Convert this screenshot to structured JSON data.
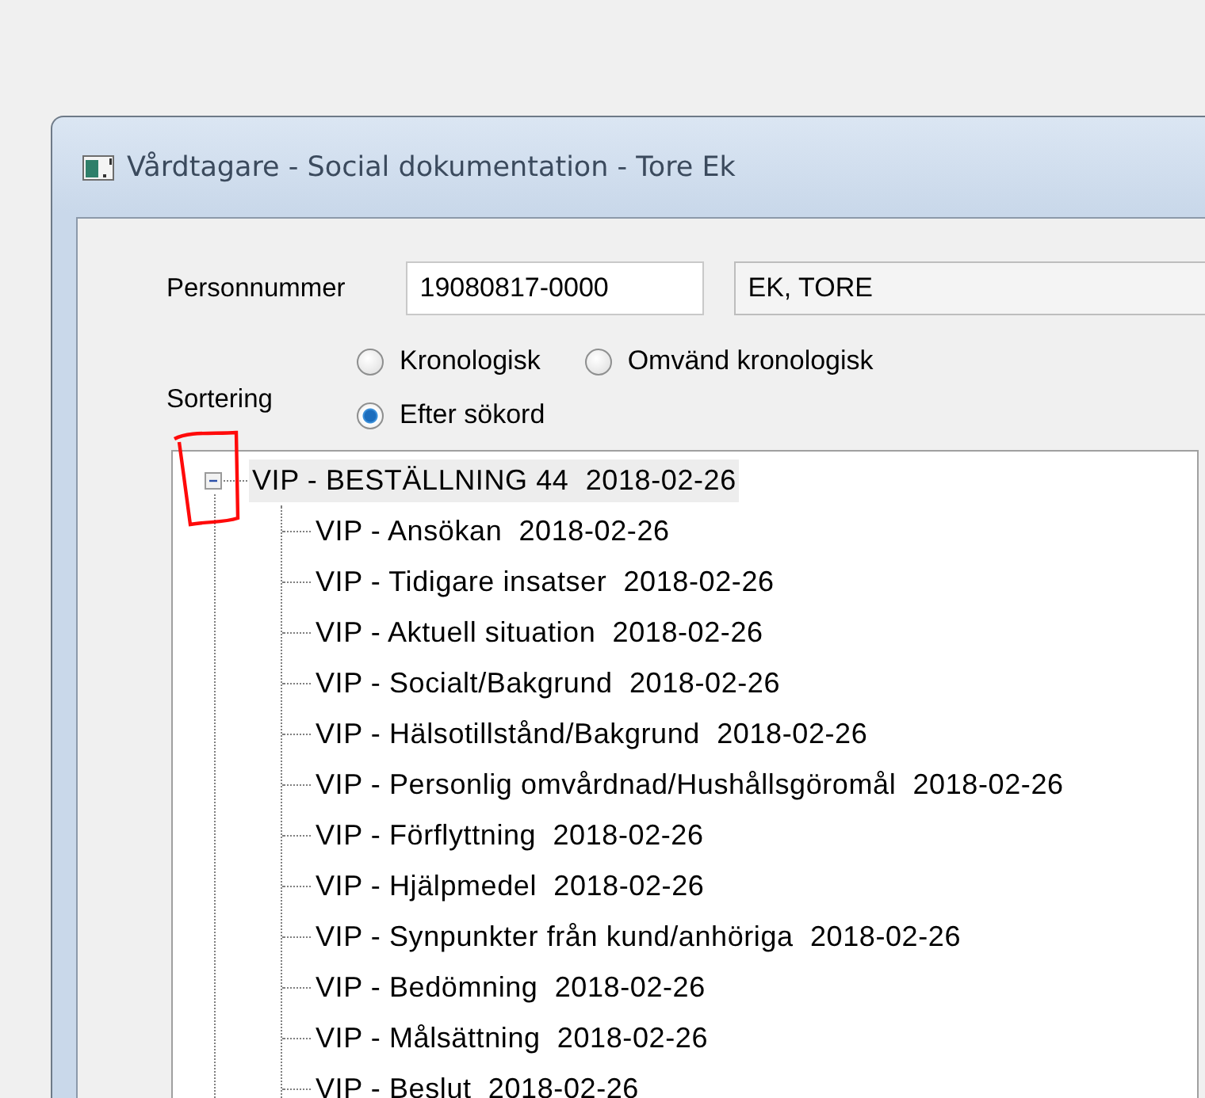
{
  "window": {
    "title": "Vårdtagare - Social dokumentation - Tore Ek"
  },
  "personnummer": {
    "label": "Personnummer",
    "value": "19080817-0000",
    "name_value": "EK, TORE"
  },
  "sorting": {
    "label": "Sortering",
    "options": [
      {
        "label": "Kronologisk",
        "selected": false
      },
      {
        "label": "Omvänd kronologisk",
        "selected": false
      },
      {
        "label": "Efter sökord",
        "selected": true
      }
    ]
  },
  "tree": {
    "label": "VIP - BESTÄLLNING 44  2018-02-26",
    "expanded": true,
    "selected": true,
    "children": [
      {
        "label": "VIP - Ansökan  2018-02-26",
        "selected": false
      },
      {
        "label": "VIP - Tidigare insatser  2018-02-26",
        "selected": false
      },
      {
        "label": "VIP - Aktuell situation  2018-02-26",
        "selected": false
      },
      {
        "label": "VIP - Socialt/Bakgrund  2018-02-26",
        "selected": false
      },
      {
        "label": "VIP - Hälsotillstånd/Bakgrund  2018-02-26",
        "selected": false
      },
      {
        "label": "VIP - Personlig omvårdnad/Hushållsgöromål  2018-02-26",
        "selected": false
      },
      {
        "label": "VIP - Förflyttning  2018-02-26",
        "selected": false
      },
      {
        "label": "VIP - Hjälpmedel  2018-02-26",
        "selected": false
      },
      {
        "label": "VIP - Synpunkter från kund/anhöriga  2018-02-26",
        "selected": false
      },
      {
        "label": "VIP - Bedömning  2018-02-26",
        "selected": false
      },
      {
        "label": "VIP - Målsättning  2018-02-26",
        "selected": false
      },
      {
        "label": "VIP - Beslut  2018-02-26",
        "selected": false
      }
    ]
  }
}
